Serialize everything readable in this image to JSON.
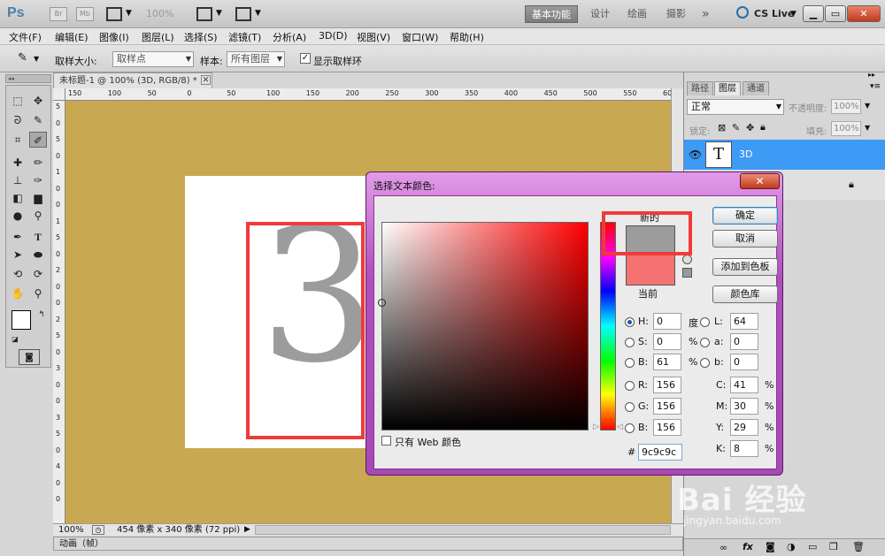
{
  "titlebar": {
    "app_logo": "Ps",
    "bridge": "Br",
    "mini_bridge": "Mb",
    "zoom": "100%",
    "workspaces": [
      "基本功能",
      "设计",
      "绘画",
      "摄影"
    ],
    "more": "»",
    "cslive": "CS Live"
  },
  "menu": [
    "文件(F)",
    "编辑(E)",
    "图像(I)",
    "图层(L)",
    "选择(S)",
    "滤镜(T)",
    "分析(A)",
    "3D(D)",
    "视图(V)",
    "窗口(W)",
    "帮助(H)"
  ],
  "options": {
    "sample_size_label": "取样大小:",
    "sample_size_value": "取样点",
    "sample_label": "样本:",
    "sample_value": "所有图层",
    "show_ring_label": "显示取样环",
    "show_ring_checked": "✓"
  },
  "document": {
    "tab_title": "未标题-1 @ 100% (3D, RGB/8) *",
    "tab_close": "✕",
    "canvas_text": "3",
    "ruler_h": [
      "150",
      "100",
      "50",
      "0",
      "50",
      "100",
      "150",
      "200",
      "250",
      "300",
      "350",
      "400",
      "450",
      "500",
      "550",
      "600"
    ],
    "ruler_v": [
      "5",
      "0",
      "5",
      "0",
      "1",
      "0",
      "0",
      "1",
      "5",
      "0",
      "2",
      "0",
      "0",
      "2",
      "5",
      "0",
      "3",
      "0",
      "0",
      "3",
      "5",
      "0",
      "4",
      "0",
      "0"
    ],
    "zoom": "100%",
    "doc_size": "454 像素 x 340 像素 (72 ppi)"
  },
  "animation_panel": "动画（帧）",
  "layers_panel": {
    "tabs": [
      "路径",
      "图层",
      "通道"
    ],
    "blend_mode": "正常",
    "opacity_label": "不透明度:",
    "opacity_value": "100%",
    "lock_label": "锁定:",
    "fill_label": "填充:",
    "fill_value": "100%",
    "layers": [
      {
        "thumb": "T",
        "name": "3D",
        "selected": true
      }
    ]
  },
  "color_picker": {
    "title": "选择文本颜色:",
    "close": "✕",
    "new_label": "新的",
    "current_label": "当前",
    "ok": "确定",
    "cancel": "取消",
    "add_swatch": "添加到色板",
    "color_libraries": "颜色库",
    "hsb": [
      {
        "label": "H:",
        "value": "0",
        "unit": "度",
        "selected": true
      },
      {
        "label": "S:",
        "value": "0",
        "unit": "%"
      },
      {
        "label": "B:",
        "value": "61",
        "unit": "%"
      }
    ],
    "lab": [
      {
        "label": "L:",
        "value": "64"
      },
      {
        "label": "a:",
        "value": "0"
      },
      {
        "label": "b:",
        "value": "0"
      }
    ],
    "rgb": [
      {
        "label": "R:",
        "value": "156"
      },
      {
        "label": "G:",
        "value": "156"
      },
      {
        "label": "B:",
        "value": "156"
      }
    ],
    "cmyk": [
      {
        "label": "C:",
        "value": "41",
        "unit": "%"
      },
      {
        "label": "M:",
        "value": "30",
        "unit": "%"
      },
      {
        "label": "Y:",
        "value": "29",
        "unit": "%"
      },
      {
        "label": "K:",
        "value": "8",
        "unit": "%"
      }
    ],
    "hex_label": "#",
    "hex": "9c9c9c",
    "web_only": "只有 Web 颜色",
    "new_color": "#9c9c9c",
    "current_color": "#f47272"
  },
  "watermark": {
    "main": "Bai 经验",
    "url": "jingyan.baidu.com"
  },
  "colors": {
    "canvas_background": "#c8a952",
    "highlight": "#f03a3a",
    "selection": "#3d9af5"
  }
}
